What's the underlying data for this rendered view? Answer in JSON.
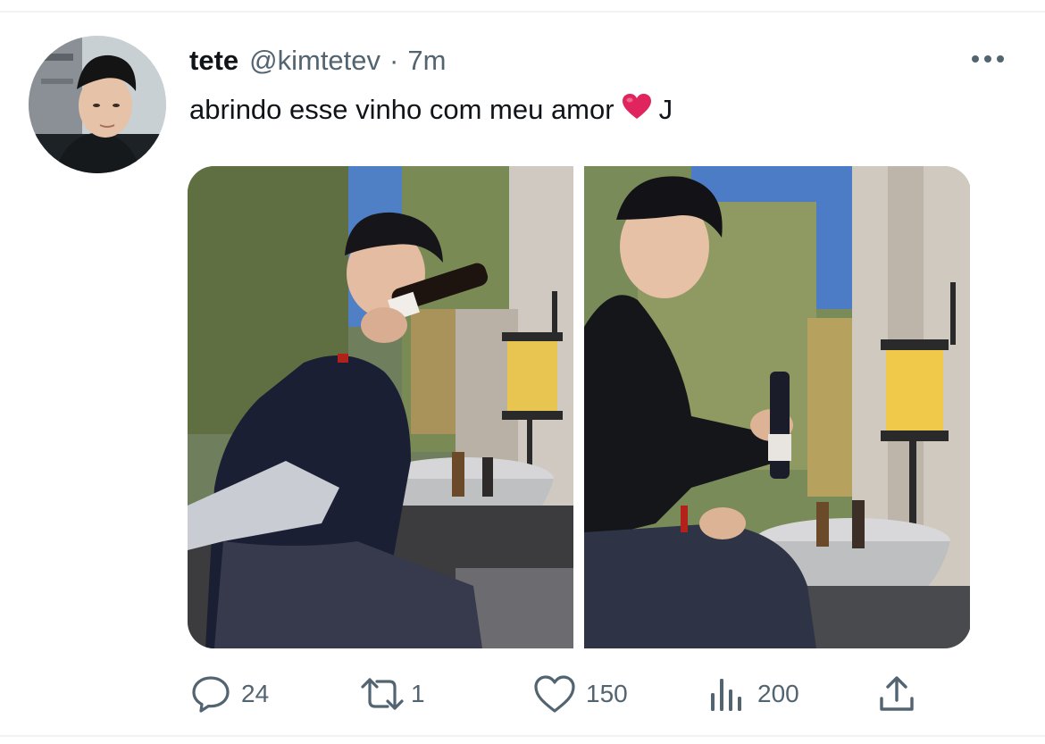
{
  "tweet": {
    "display_name": "tete",
    "handle": "@kimtetev",
    "separator": "·",
    "time": "7m",
    "text_before": "abrindo esse vinho com meu amor",
    "emoji": "❤️",
    "text_after": "J"
  },
  "media": {
    "photo_count": 2
  },
  "actions": {
    "replies": "24",
    "retweets": "1",
    "likes": "150",
    "views": "200"
  },
  "icons": {
    "more": "more-horizontal-icon",
    "reply": "speech-bubble-icon",
    "retweet": "retweet-arrows-icon",
    "like": "heart-outline-icon",
    "views": "bar-chart-icon",
    "share": "share-upload-icon"
  },
  "colors": {
    "text_primary": "#0f1419",
    "text_secondary": "#536471",
    "divider": "#eff3f4",
    "heart_emoji": "#e0245e"
  }
}
